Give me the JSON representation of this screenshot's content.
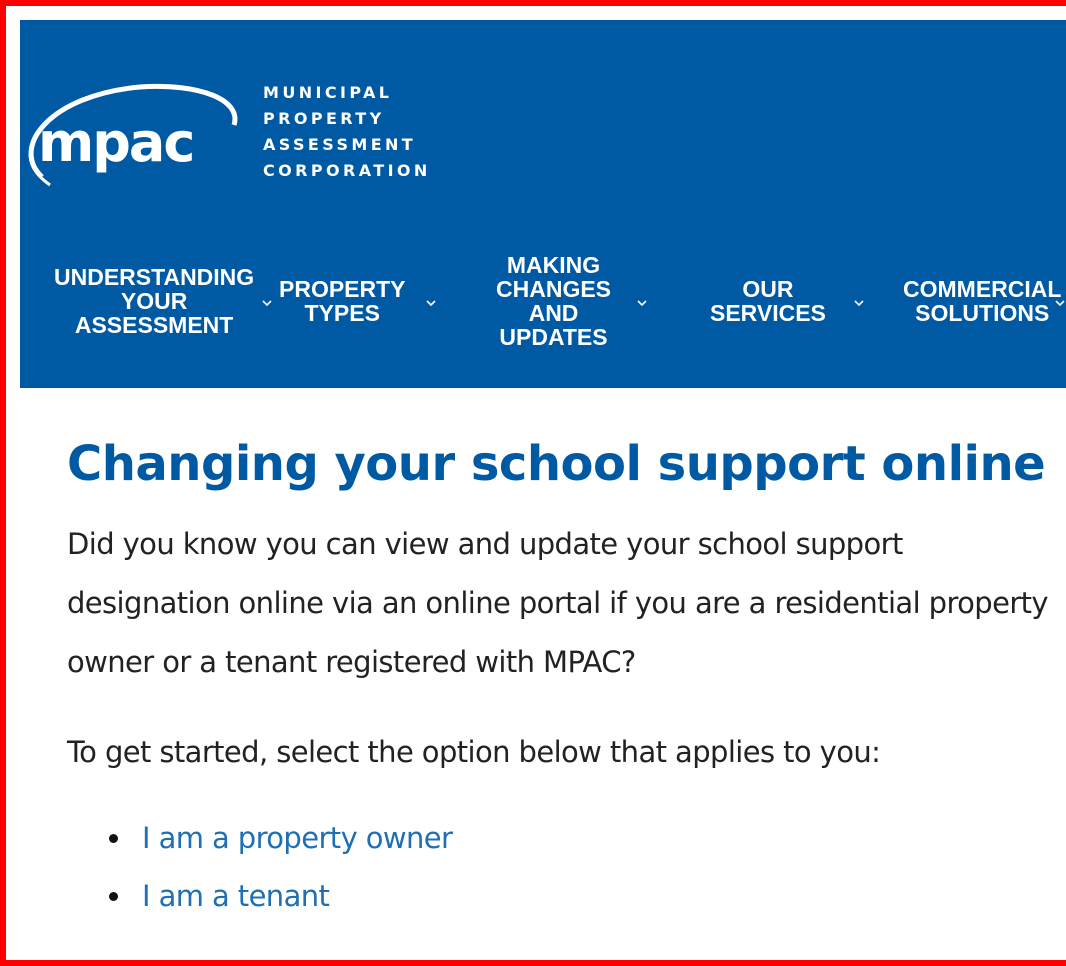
{
  "header": {
    "logo_text": "mpac",
    "tagline": [
      "MUNICIPAL",
      "PROPERTY",
      "ASSESSMENT",
      "CORPORATION"
    ],
    "brand_color": "#005aa3",
    "nav": [
      {
        "label": "UNDERSTANDING\nYOUR\nASSESSMENT"
      },
      {
        "label": "PROPERTY\nTYPES"
      },
      {
        "label": "MAKING\nCHANGES\nAND\nUPDATES"
      },
      {
        "label": "OUR\nSERVICES"
      },
      {
        "label": "COMMERCIAL\nSOLUTIONS"
      }
    ]
  },
  "main": {
    "title": "Changing your school support online",
    "intro": "Did you know you can view and update your school support designation online via an online portal if you are a residential property owner or a tenant registered with MPAC?",
    "prompt": "To get started, select the option below that applies to you:",
    "options": [
      {
        "label": "I am a property owner"
      },
      {
        "label": "I am a tenant"
      }
    ],
    "link_color": "#1f6fb4"
  },
  "frame_color": "#ff0000"
}
